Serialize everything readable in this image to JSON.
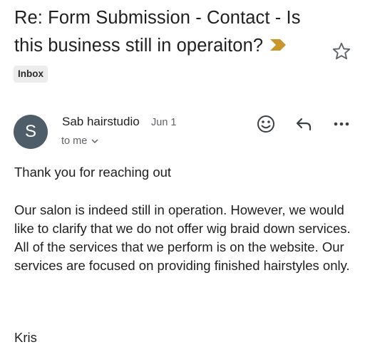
{
  "email": {
    "subject": "Re: Form Submission - Contact - Is this business still in operaiton?",
    "label": "Inbox",
    "sender": {
      "initial": "S",
      "name": "Sab hairstudio",
      "date": "Jun 1",
      "recipient": "to me"
    },
    "body": {
      "greeting": "Thank you for reaching out",
      "paragraph": "Our salon is indeed still in operation. However, we would like to clarify that we do not offer wig braid down services. All of the services that we perform is on the website. Our services are focused on providing finished hairstyles only.",
      "signature": "Kris"
    }
  },
  "icons": {
    "importance": "importance-marker-icon",
    "star": "star-outline-icon",
    "emoji": "emoji-smile-icon",
    "reply": "reply-arrow-icon",
    "more": "more-horizontal-icon",
    "expand": "chevron-down-icon"
  },
  "colors": {
    "importance_marker": "#C9962B",
    "avatar_background": "#4F5D68",
    "label_background": "#ECECEC",
    "secondary_text": "#5F6368",
    "primary_text": "#1F1F1F"
  }
}
